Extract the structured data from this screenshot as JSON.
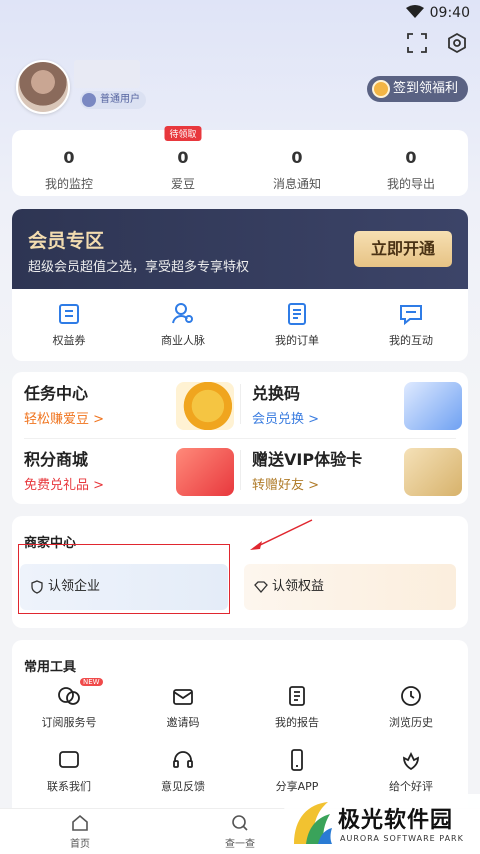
{
  "status": {
    "time": "09:40"
  },
  "profile": {
    "badge": "普通用户",
    "checkin": "签到领福利"
  },
  "stats": [
    {
      "num": "0",
      "label": "我的监控"
    },
    {
      "num": "0",
      "label": "爱豆",
      "tag": "待领取"
    },
    {
      "num": "0",
      "label": "消息通知"
    },
    {
      "num": "0",
      "label": "我的导出"
    }
  ],
  "vip": {
    "title": "会员专区",
    "subtitle": "超级会员超值之选，享受超多专享特权",
    "button": "立即开通"
  },
  "quick": [
    {
      "label": "权益券",
      "icon": "voucher-icon"
    },
    {
      "label": "商业人脉",
      "icon": "contacts-icon"
    },
    {
      "label": "我的订单",
      "icon": "order-icon"
    },
    {
      "label": "我的互动",
      "icon": "chat-icon"
    }
  ],
  "tasks": [
    {
      "title": "任务中心",
      "sub": "轻松赚爱豆 >",
      "color": "#f0741e"
    },
    {
      "title": "兑换码",
      "sub": "会员兑换 >",
      "color": "#3b7de0"
    },
    {
      "title": "积分商城",
      "sub": "免费兑礼品 >",
      "color": "#e8383d"
    },
    {
      "title": "赠送VIP体验卡",
      "sub": "转赠好友 >",
      "color": "#b07c2a"
    }
  ],
  "merchant": {
    "title": "商家中心",
    "claim_company": "认领企业",
    "claim_rights": "认领权益"
  },
  "tools": {
    "title": "常用工具",
    "new_tag": "NEW",
    "items": [
      {
        "label": "订阅服务号",
        "icon": "subscribe-icon"
      },
      {
        "label": "邀请码",
        "icon": "invite-icon"
      },
      {
        "label": "我的报告",
        "icon": "report-icon"
      },
      {
        "label": "浏览历史",
        "icon": "history-icon"
      },
      {
        "label": "联系我们",
        "icon": "contact-icon"
      },
      {
        "label": "意见反馈",
        "icon": "feedback-icon"
      },
      {
        "label": "分享APP",
        "icon": "share-icon"
      },
      {
        "label": "给个好评",
        "icon": "rate-icon"
      }
    ]
  },
  "tabbar": [
    {
      "label": "首页",
      "icon": "home-icon"
    },
    {
      "label": "查一查",
      "icon": "search-icon"
    }
  ],
  "watermark": {
    "cn": "极光软件园",
    "en": "AURORA SOFTWARE PARK"
  }
}
